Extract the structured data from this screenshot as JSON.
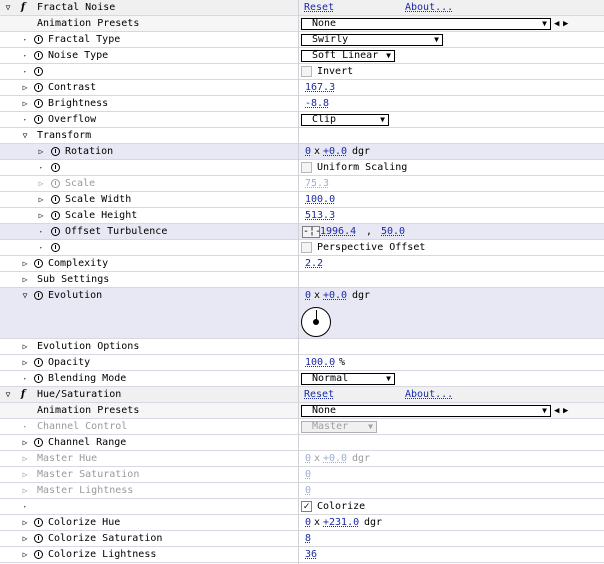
{
  "fractal_noise": {
    "title": "Fractal Noise",
    "reset": "Reset",
    "about": "About...",
    "animation_presets": {
      "label": "Animation Presets",
      "value": "None"
    },
    "fractal_type": {
      "label": "Fractal Type",
      "value": "Swirly"
    },
    "noise_type": {
      "label": "Noise Type",
      "value": "Soft Linear"
    },
    "invert": {
      "label": "Invert",
      "checked": false
    },
    "contrast": {
      "label": "Contrast",
      "value": "167.3"
    },
    "brightness": {
      "label": "Brightness",
      "value": "-8.8"
    },
    "overflow": {
      "label": "Overflow",
      "value": "Clip"
    },
    "transform": {
      "label": "Transform",
      "rotation": {
        "label": "Rotation",
        "rev": "0",
        "x": "x",
        "deg": "+0.0",
        "unit": "dgr"
      },
      "uniform_scaling": {
        "label": "Uniform Scaling",
        "checked": false
      },
      "scale": {
        "label": "Scale",
        "value": "75.3"
      },
      "scale_width": {
        "label": "Scale Width",
        "value": "100.0"
      },
      "scale_height": {
        "label": "Scale Height",
        "value": "513.3"
      },
      "offset_turbulence": {
        "label": "Offset Turbulence",
        "x": "1996.4",
        "sep": ",",
        "y": "50.0"
      },
      "perspective_offset": {
        "label": "Perspective Offset",
        "checked": false
      }
    },
    "complexity": {
      "label": "Complexity",
      "value": "2.2"
    },
    "sub_settings": {
      "label": "Sub Settings"
    },
    "evolution": {
      "label": "Evolution",
      "rev": "0",
      "x": "x",
      "deg": "+0.0",
      "unit": "dgr"
    },
    "evolution_options": {
      "label": "Evolution Options"
    },
    "opacity": {
      "label": "Opacity",
      "value": "100.0",
      "unit": "%"
    },
    "blending_mode": {
      "label": "Blending Mode",
      "value": "Normal"
    }
  },
  "hue_saturation": {
    "title": "Hue/Saturation",
    "reset": "Reset",
    "about": "About...",
    "animation_presets": {
      "label": "Animation Presets",
      "value": "None"
    },
    "channel_control": {
      "label": "Channel Control",
      "value": "Master"
    },
    "channel_range": {
      "label": "Channel Range"
    },
    "master_hue": {
      "label": "Master Hue",
      "rev": "0",
      "x": "x",
      "deg": "+0.0",
      "unit": "dgr"
    },
    "master_saturation": {
      "label": "Master Saturation",
      "value": "0"
    },
    "master_lightness": {
      "label": "Master Lightness",
      "value": "0"
    },
    "colorize": {
      "label": "Colorize",
      "checked": true
    },
    "colorize_hue": {
      "label": "Colorize Hue",
      "rev": "0",
      "x": "x",
      "deg": "+231.0",
      "unit": "dgr"
    },
    "colorize_saturation": {
      "label": "Colorize Saturation",
      "value": "8"
    },
    "colorize_lightness": {
      "label": "Colorize Lightness",
      "value": "36"
    }
  },
  "icons": {
    "expand": "▷",
    "collapse": "▽",
    "small_arrow": "▸",
    "dropdown": "▼",
    "prev": "◀",
    "next": "▶",
    "check": "✓",
    "crosshair": "-¦-",
    "fx": "f"
  },
  "colors": {
    "link": "#1a2aa8",
    "highlight_row": "#e8e8f4",
    "disabled": "#9a9a9a"
  }
}
